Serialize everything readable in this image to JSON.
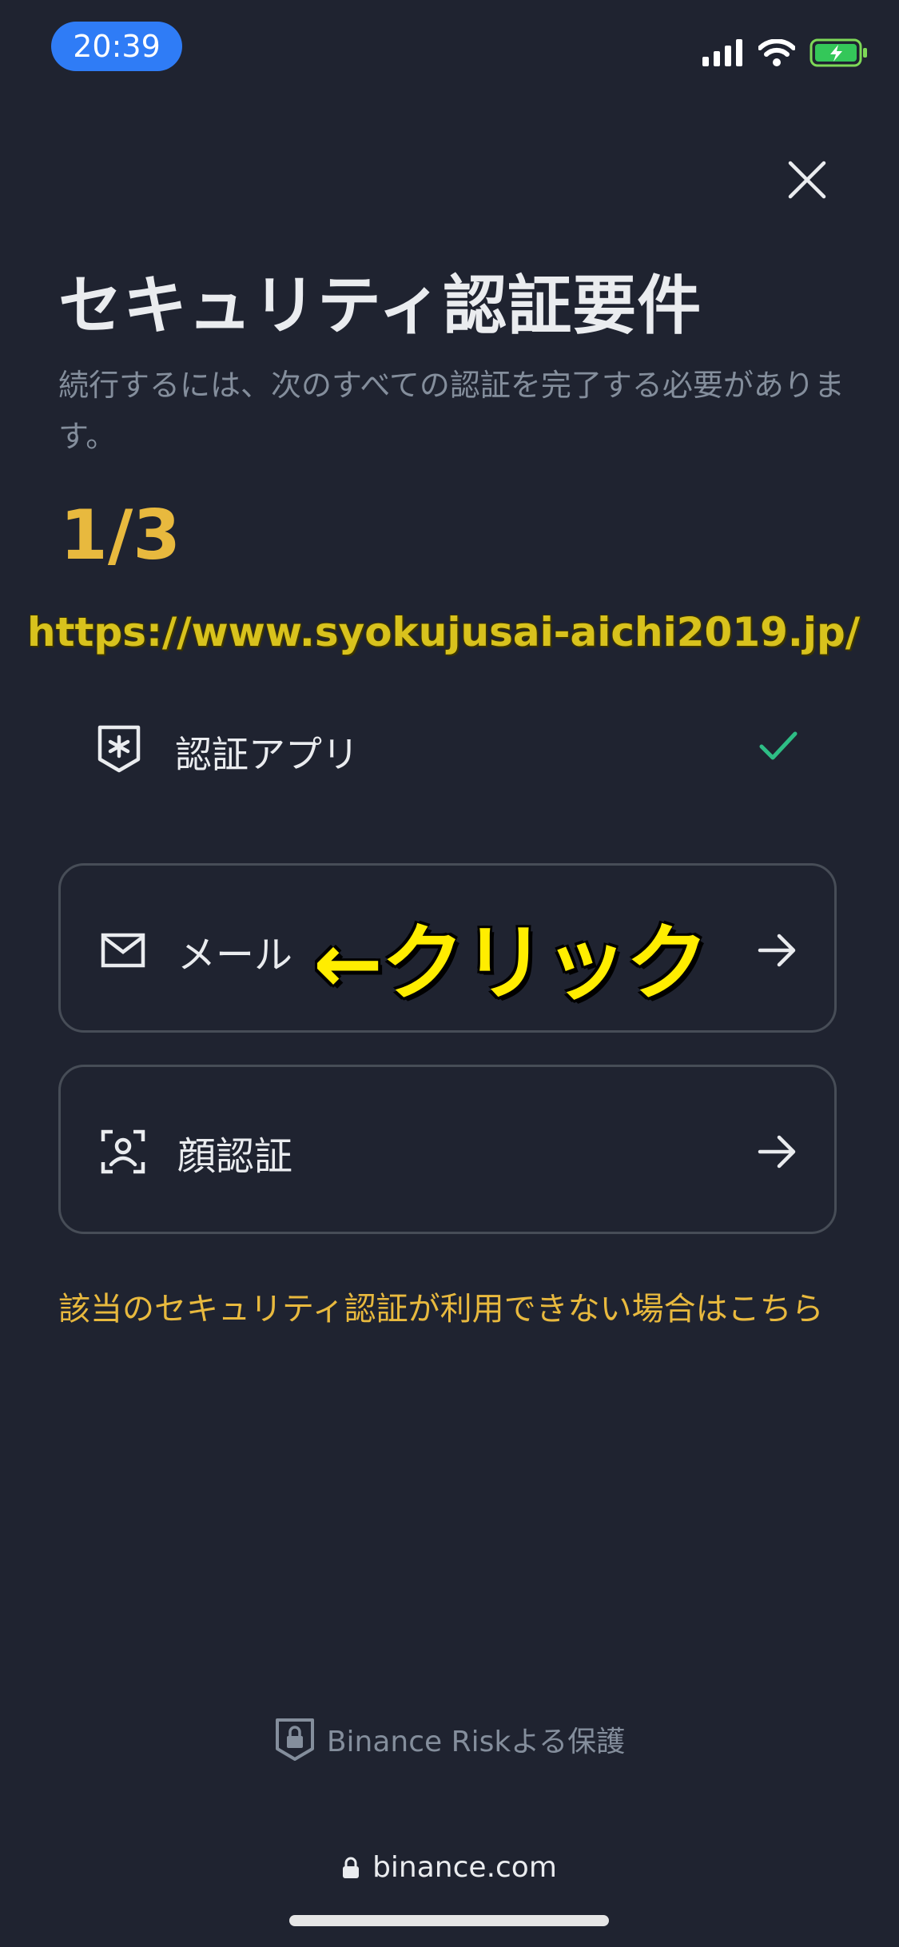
{
  "status_bar": {
    "time": "20:39"
  },
  "header": {
    "title": "セキュリティ認証要件",
    "subtitle": "続行するには、次のすべての認証を完了する必要があります。",
    "progress": "1/3"
  },
  "overlay": {
    "watermark_url": "https://www.syokujusai-aichi2019.jp/",
    "click_note": "←クリック"
  },
  "verifications": [
    {
      "label": "認証アプリ",
      "status": "completed"
    },
    {
      "label": "メール",
      "status": "pending"
    },
    {
      "label": "顔認証",
      "status": "pending"
    }
  ],
  "help_link": "該当のセキュリティ認証が利用できない場合はこちら",
  "footer": {
    "protection": "Binance Riskよる保護",
    "domain": "binance.com"
  },
  "colors": {
    "background": "#1f2330",
    "accent": "#e8b93e",
    "success": "#2ebd85",
    "muted_text": "#848e9c",
    "border": "#474d57"
  }
}
